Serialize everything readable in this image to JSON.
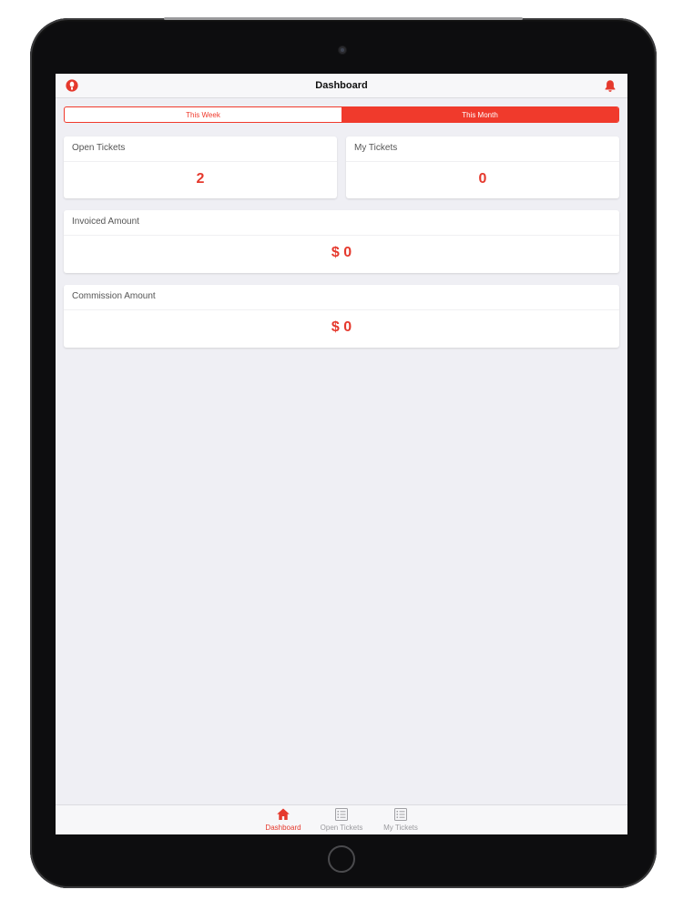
{
  "nav": {
    "title": "Dashboard",
    "logo_icon": "logo-icon",
    "bell_icon": "bell-icon"
  },
  "segment": {
    "options": [
      "This Week",
      "This Month"
    ],
    "selected": "This Month"
  },
  "cards": {
    "open_tickets": {
      "label": "Open Tickets",
      "value": "2"
    },
    "my_tickets": {
      "label": "My Tickets",
      "value": "0"
    },
    "invoiced_amount": {
      "label": "Invoiced Amount",
      "value": "$ 0"
    },
    "commission_amount": {
      "label": "Commission Amount",
      "value": "$ 0"
    }
  },
  "tabbar": {
    "tabs": [
      {
        "label": "Dashboard",
        "icon": "home-icon",
        "active": true
      },
      {
        "label": "Open Tickets",
        "icon": "list-icon",
        "active": false
      },
      {
        "label": "My Tickets",
        "icon": "list-icon",
        "active": false
      }
    ]
  },
  "colors": {
    "accent": "#f03a2c",
    "background": "#efeff4"
  }
}
